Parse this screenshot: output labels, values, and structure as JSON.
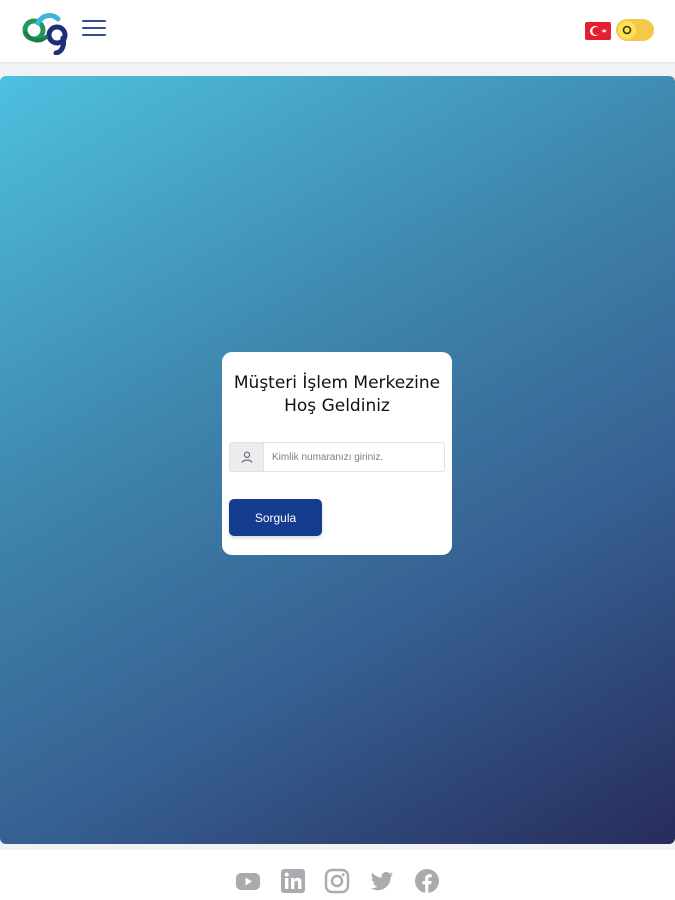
{
  "header": {
    "logo_icon": "brand-logo-icon",
    "menu_icon": "hamburger-menu-icon",
    "language_flag": "turkey-flag-icon",
    "theme_toggle_icon": "sun-icon"
  },
  "login_card": {
    "title": "Müşteri İşlem Merkezine Hoş Geldiniz",
    "input_icon": "user-icon",
    "id_input_value": "",
    "id_input_placeholder": "Kimlik numaranızı giriniz.",
    "submit_label": "Sorgula"
  },
  "footer": {
    "social_links": [
      {
        "icon": "youtube-icon"
      },
      {
        "icon": "linkedin-icon"
      },
      {
        "icon": "instagram-icon"
      },
      {
        "icon": "twitter-icon"
      },
      {
        "icon": "facebook-icon"
      }
    ]
  },
  "colors": {
    "primary_button": "#143d8f",
    "menu_icon": "#2f4d9a",
    "gradient_start": "#4ec0df",
    "gradient_end": "#272c5c",
    "toggle": "#f5c84a",
    "social_icon": "#a9abaf"
  }
}
